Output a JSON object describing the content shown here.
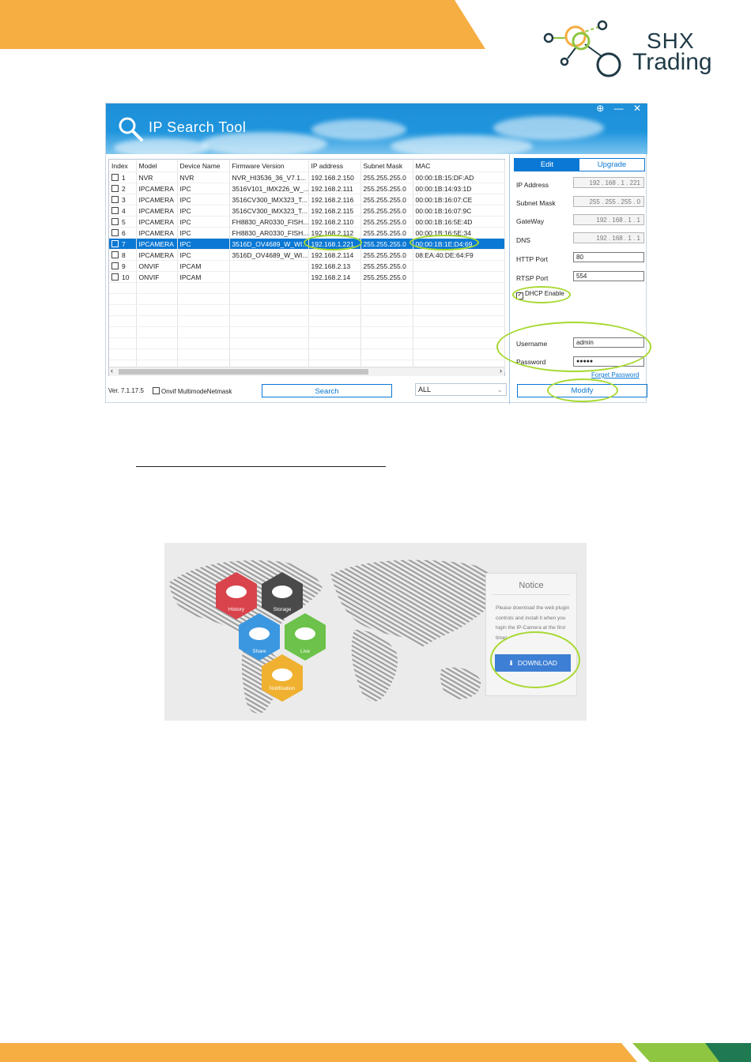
{
  "brand": {
    "line1": "SHX",
    "line2": "Trading",
    "colors": {
      "orange": "#f6ad42",
      "navy": "#1f3a46",
      "green": "#8ec641"
    }
  },
  "ip_tool": {
    "title": "IP Search Tool",
    "window_controls": [
      "⊕",
      "—",
      "✕"
    ],
    "columns": [
      "Index",
      "Model",
      "Device Name",
      "Firmware Version",
      "IP address",
      "Subnet Mask",
      "MAC"
    ],
    "rows": [
      [
        "1",
        "NVR",
        "NVR",
        "NVR_HI3536_36_V7.1...",
        "192.168.2.150",
        "255.255.255.0",
        "00:00:1B:15:DF:AD"
      ],
      [
        "2",
        "IPCAMERA",
        "IPC",
        "3516V101_IMX226_W_...",
        "192.168.2.111",
        "255.255.255.0",
        "00:00:1B:14:93:1D"
      ],
      [
        "3",
        "IPCAMERA",
        "IPC",
        "3516CV300_IMX323_T...",
        "192.168.2.116",
        "255.255.255.0",
        "00:00:1B:16:07:CE"
      ],
      [
        "4",
        "IPCAMERA",
        "IPC",
        "3516CV300_IMX323_T...",
        "192.168.2.115",
        "255.255.255.0",
        "00:00:1B:16:07:9C"
      ],
      [
        "5",
        "IPCAMERA",
        "IPC",
        "FH8830_AR0330_FISH...",
        "192.168.2.110",
        "255.255.255.0",
        "00:00:1B:16:5E:4D"
      ],
      [
        "6",
        "IPCAMERA",
        "IPC",
        "FH8830_AR0330_FISH...",
        "192.168.2.112",
        "255.255.255.0",
        "00:00:1B:16:5E:34"
      ],
      [
        "7",
        "IPCAMERA",
        "IPC",
        "3516D_OV4689_W_WI...",
        "192.168.1.221",
        "255.255.255.0",
        "00:00:1B:1E:D4:69"
      ],
      [
        "8",
        "IPCAMERA",
        "IPC",
        "3516D_OV4689_W_WI...",
        "192.168.2.114",
        "255.255.255.0",
        "08:EA:40:DE:64:F9"
      ],
      [
        "9",
        "ONVIF",
        "IPCAM",
        "",
        "192.168.2.13",
        "255.255.255.0",
        ""
      ],
      [
        "10",
        "ONVIF",
        "IPCAM",
        "",
        "192.168.2.14",
        "255.255.255.0",
        ""
      ]
    ],
    "selected_row": 7,
    "version": "Ver. 7.1.17.5",
    "onvif_label": "Onvif MultimodeNetmask",
    "search_label": "Search",
    "filter_value": "ALL",
    "tabs": {
      "edit": "Edit",
      "upgrade": "Upgrade"
    },
    "form": {
      "ip_label": "IP Address",
      "ip_value": "192 . 168 . 1 . 221",
      "mask_label": "Subnet Mask",
      "mask_value": "255 . 255 . 255 . 0",
      "gateway_label": "GateWay",
      "gateway_value": "192 . 168 . 1 . 1",
      "dns_label": "DNS",
      "dns_value": "192 . 168 . 1 . 1",
      "http_label": "HTTP Port",
      "http_value": "80",
      "rtsp_label": "RTSP Port",
      "rtsp_value": "554",
      "dhcp_label": "DHCP Enable",
      "username_label": "Username",
      "username_value": "admin",
      "password_label": "Password",
      "password_value": "●●●●●",
      "forget_label": "Forget Password",
      "modify_label": "Modify"
    },
    "highlight_color": "#a7d931"
  },
  "web_login": {
    "hexes": [
      "History",
      "Storage",
      "Share",
      "Live",
      "Notification"
    ],
    "hex_colors": [
      "#d9434b",
      "#4a4a4a",
      "#3b97e0",
      "#6cc24a",
      "#f0b130"
    ],
    "notice_title": "Notice",
    "notice_message": "Please download the web plugin controls and install it when you login the IP-Camera at the first time!",
    "download_label": "DOWNLOAD"
  }
}
